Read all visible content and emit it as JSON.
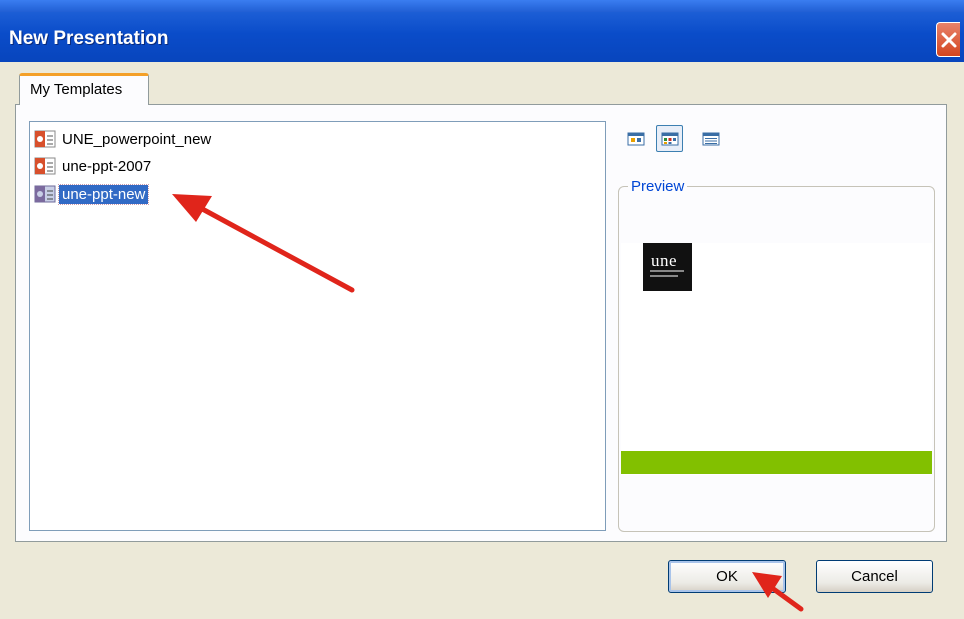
{
  "window": {
    "title": "New Presentation"
  },
  "tabs": [
    {
      "label": "My Templates"
    }
  ],
  "templates": [
    {
      "label": "UNE_powerpoint_new",
      "selected": false
    },
    {
      "label": "une-ppt-2007",
      "selected": false
    },
    {
      "label": "une-ppt-new",
      "selected": true
    }
  ],
  "view_buttons": [
    "large-icons-view-icon",
    "list-view-icon",
    "details-view-icon"
  ],
  "preview": {
    "legend": "Preview",
    "logo_text": "une",
    "accent_color": "#82c000"
  },
  "buttons": {
    "ok": "OK",
    "cancel": "Cancel"
  },
  "colors": {
    "titlebar": "#0a4cc9",
    "selection": "#316ac5",
    "annotation_arrow": "#e0251b"
  }
}
